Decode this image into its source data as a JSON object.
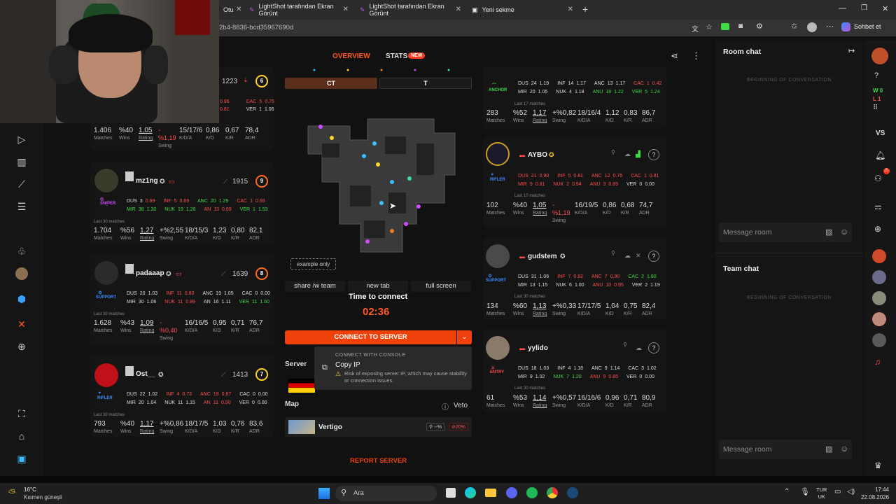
{
  "browser": {
    "tabs": [
      {
        "label": "Oturum"
      },
      {
        "label": "LightShot tarafından Ekran Görünt"
      },
      {
        "label": "LightShot tarafından Ekran Görünt"
      },
      {
        "label": "Yeni sekme"
      }
    ],
    "url_fragment": "2b4-8836-bcd35967690d",
    "profile_button": "Sohbet et"
  },
  "header": {
    "overview_tab": "OVERVIEW",
    "stats_tab": "STATS",
    "stats_badge": "NEW"
  },
  "team_left": [
    {
      "name": "",
      "elo": "1223",
      "level": "6",
      "stats": {
        "matches": "1.406",
        "wins": "%40",
        "rating": "1,05",
        "swing": "%1,19",
        "kda": "15/17/6",
        "kd": "0,86",
        "kr": "0,67",
        "adr": "78,4"
      },
      "maprows": [
        {
          "m": "",
          "v": "",
          "c1": "CAC",
          "c1v": "5",
          "c1v2": "0.75"
        },
        {
          "c1": "VER",
          "c1v": "1",
          "c1v2": "1.06"
        }
      ]
    },
    {
      "name": "mz1ng",
      "elo": "1915",
      "level": "9",
      "role": "SNIPER",
      "row1": [
        "DUS",
        "3",
        "0.69",
        "INF",
        "5",
        "0.69",
        "ANC",
        "20",
        "1.29",
        "CAC",
        "1",
        "0.69"
      ],
      "row2": [
        "MIR",
        "36",
        "1.30",
        "NUK",
        "19",
        "1.26",
        "AN",
        "13",
        "0.69",
        "VER",
        "1",
        "1.53"
      ],
      "last": "Last 30 matches",
      "stats": {
        "matches": "1.704",
        "wins": "%56",
        "rating": "1,27",
        "swing": "+%2,55",
        "kda": "18/15/3",
        "kd": "1,23",
        "kr": "0,80",
        "adr": "82,1"
      }
    },
    {
      "name": "padaaap",
      "elo": "1639",
      "level": "8",
      "role": "SUPPORT",
      "row1": [
        "DUS",
        "20",
        "1.03",
        "INF",
        "11",
        "0.80",
        "ANC",
        "19",
        "1.05",
        "CAC",
        "0",
        "0.00"
      ],
      "row2": [
        "MIR",
        "30",
        "1.06",
        "NUK",
        "11",
        "0.89",
        "AN",
        "16",
        "1.11",
        "VER",
        "11",
        "1.50"
      ],
      "last": "Last 30 matches",
      "stats": {
        "matches": "1.628",
        "wins": "%43",
        "rating": "1,09",
        "swing": "%0,40",
        "kda": "16/16/5",
        "kd": "0,95",
        "kr": "0,71",
        "adr": "76,7"
      }
    },
    {
      "name": "Ost__",
      "elo": "1413",
      "level": "7",
      "role": "RIFLER",
      "row1": [
        "DUS",
        "22",
        "1.02",
        "INF",
        "4",
        "0.73",
        "ANC",
        "18",
        "0.87",
        "CAC",
        "0",
        "0.00"
      ],
      "row2": [
        "MIR",
        "20",
        "1.04",
        "NUK",
        "11",
        "1.15",
        "AN",
        "11",
        "0.90",
        "VER",
        "0",
        "0.00"
      ],
      "last": "Last 30 matches",
      "stats": {
        "matches": "793",
        "wins": "%40",
        "rating": "1,17",
        "swing": "+%0,86",
        "kda": "18/17/5",
        "kd": "1,03",
        "kr": "0,76",
        "adr": "83,6"
      }
    }
  ],
  "team_right": [
    {
      "name": "",
      "role": "ANCHOR",
      "row1": [
        "DUS",
        "24",
        "1.19",
        "INF",
        "14",
        "1.17",
        "ANC",
        "13",
        "1.17",
        "CAC",
        "1",
        "0.42"
      ],
      "row2": [
        "MIR",
        "20",
        "1.05",
        "NUK",
        "4",
        "1.18",
        "ANU",
        "18",
        "1.22",
        "VER",
        "5",
        "1.24"
      ],
      "last": "Last 17 matches",
      "stats": {
        "matches": "283",
        "wins": "%52",
        "rating": "1,17",
        "swing": "+%0,82",
        "kda": "18/16/4",
        "kd": "1,12",
        "kr": "0,83",
        "adr": "86,7"
      }
    },
    {
      "name": "AYBO",
      "role": "RIFLER",
      "row1": [
        "DUS",
        "21",
        "0.90",
        "INF",
        "5",
        "0.81",
        "ANC",
        "12",
        "0.75",
        "CAC",
        "1",
        "0.81"
      ],
      "row2": [
        "MIR",
        "9",
        "0.81",
        "NUK",
        "2",
        "0.94",
        "ANU",
        "3",
        "0.89",
        "VER",
        "0",
        "0.00"
      ],
      "last": "Last 10 matches",
      "stats": {
        "matches": "102",
        "wins": "%40",
        "rating": "1,05",
        "swing": "%1,19",
        "kda": "16/19/5",
        "kd": "0,86",
        "kr": "0,68",
        "adr": "74,7"
      }
    },
    {
      "name": "gudstem",
      "role": "SUPPORT",
      "row1": [
        "DUS",
        "31",
        "1.06",
        "INF",
        "7",
        "0.92",
        "ANC",
        "7",
        "0.90",
        "CAC",
        "2",
        "1.80"
      ],
      "row2": [
        "MIR",
        "13",
        "1.15",
        "NUK",
        "6",
        "1.00",
        "ANU",
        "10",
        "0.95",
        "VER",
        "2",
        "1.19"
      ],
      "last": "Last 30 matches",
      "stats": {
        "matches": "134",
        "wins": "%60",
        "rating": "1,13",
        "swing": "+%0,33",
        "kda": "17/17/5",
        "kd": "1,04",
        "kr": "0,75",
        "adr": "82,4"
      }
    },
    {
      "name": "yylido",
      "role": "ENTRY",
      "row1": [
        "DUS",
        "18",
        "1.03",
        "INF",
        "4",
        "1.18",
        "ANC",
        "9",
        "1.14",
        "CAC",
        "3",
        "1.02"
      ],
      "row2": [
        "MIR",
        "9",
        "1.02",
        "NUK",
        "7",
        "1.20",
        "ANU",
        "9",
        "0.85",
        "VER",
        "0",
        "0.00"
      ],
      "last": "Last 30 matches",
      "stats": {
        "matches": "61",
        "wins": "%53",
        "rating": "1,14",
        "swing": "+%0,57",
        "kda": "16/16/6",
        "kd": "0,96",
        "kr": "0,71",
        "adr": "80,9"
      }
    }
  ],
  "labels": {
    "matches": "Matches",
    "wins": "Wins",
    "rating": "Rating",
    "swing": "Swing",
    "kda": "K/D/A",
    "kd": "K/D",
    "kr": "K/R",
    "adr": "ADR"
  },
  "center": {
    "side_ct": "CT",
    "side_t": "T",
    "example_only": "example only",
    "share_team": "share /w team",
    "new_tab": "new tab",
    "full_screen": "full screen",
    "time_label": "Time to connect",
    "timer": "02:36",
    "connect_button": "CONNECT TO SERVER",
    "popup_header": "CONNECT WITH CONSOLE",
    "copy_ip": "Copy IP",
    "warning": "Risk of exposing server IP, which may cause stability or connection issues.",
    "server_label": "Server",
    "map_label": "Map",
    "veto": "Veto",
    "map_name": "Vertigo",
    "map_stat1": "--%",
    "map_stat2": "20%",
    "report": "REPORT SERVER"
  },
  "chat": {
    "room_title": "Room chat",
    "beginning": "BEGINNING OF CONVERSATION",
    "placeholder": "Message room",
    "team_title": "Team chat"
  },
  "sidebar": {
    "vs": "VS",
    "w": "W",
    "w_count": "0",
    "l": "L",
    "l_count": "1",
    "notif": "5"
  },
  "taskbar": {
    "temp": "16°C",
    "weather": "Kısmen güneşli",
    "search": "Ara",
    "lang1": "TUR",
    "lang2": "UK",
    "time": "17:44",
    "date": "22.08.2026"
  },
  "colors": {
    "accent": "#f0410a",
    "ct_tab": "#5a2e1b",
    "win": "#3ddc45",
    "loss": "#ff4d4d"
  }
}
